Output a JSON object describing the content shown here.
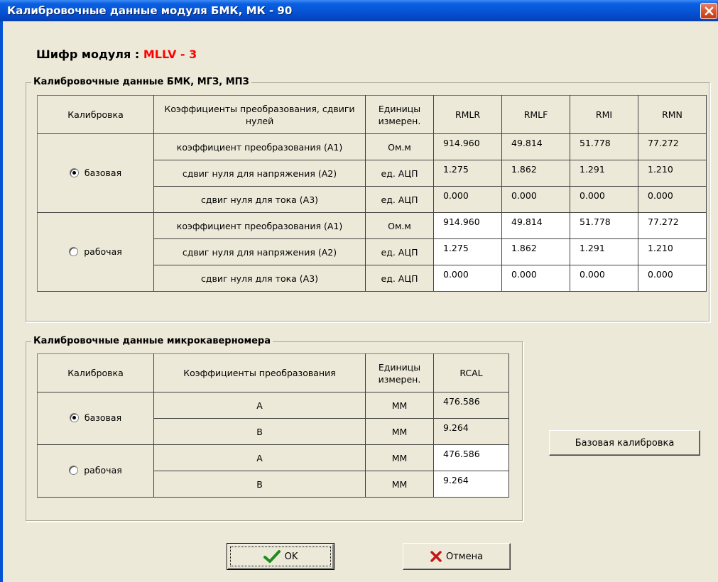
{
  "window": {
    "title": "Калибровочные данные модуля БМК, МК - 90"
  },
  "cipher": {
    "label": "Шифр модуля :",
    "value": "MLLV - 3"
  },
  "group1": {
    "title": "Калибровочные данные БМК, МГЗ, МПЗ",
    "headers": {
      "calibration": "Калибровка",
      "coeffs": "Коэффициенты преобразования, сдвиги нулей",
      "units": "Единицы измерен.",
      "cols": [
        "RMLR",
        "RMLF",
        "RMI",
        "RMN"
      ]
    },
    "modes": [
      "базовая",
      "рабочая"
    ],
    "row_labels": [
      "коэффициент преобразования (A1)",
      "сдвиг нуля для напряжения (A2)",
      "сдвиг нуля для тока (A3)"
    ],
    "row_units": [
      "Ом.м",
      "ед. АЦП",
      "ед. АЦП"
    ],
    "values": {
      "base": [
        [
          "914.960",
          "49.814",
          "51.778",
          "77.272"
        ],
        [
          "1.275",
          "1.862",
          "1.291",
          "1.210"
        ],
        [
          "0.000",
          "0.000",
          "0.000",
          "0.000"
        ]
      ],
      "work": [
        [
          "914.960",
          "49.814",
          "51.778",
          "77.272"
        ],
        [
          "1.275",
          "1.862",
          "1.291",
          "1.210"
        ],
        [
          "0.000",
          "0.000",
          "0.000",
          "0.000"
        ]
      ]
    }
  },
  "group2": {
    "title": "Калибровочные данные микрокаверномера",
    "headers": {
      "calibration": "Калибровка",
      "coeffs": "Коэффициенты преобразования",
      "units": "Единицы измерен.",
      "col": "RCAL"
    },
    "modes": [
      "базовая",
      "рабочая"
    ],
    "row_labels": [
      "A",
      "B"
    ],
    "row_units": [
      "ММ",
      "ММ"
    ],
    "values": {
      "base": [
        "476.586",
        "9.264"
      ],
      "work": [
        "476.586",
        "9.264"
      ]
    }
  },
  "buttons": {
    "base_calibration": "Базовая калибровка",
    "ok": "OK",
    "cancel": "Отмена"
  },
  "icons": {
    "close": "close-icon",
    "ok": "checkmark-icon",
    "cancel": "cross-icon"
  }
}
